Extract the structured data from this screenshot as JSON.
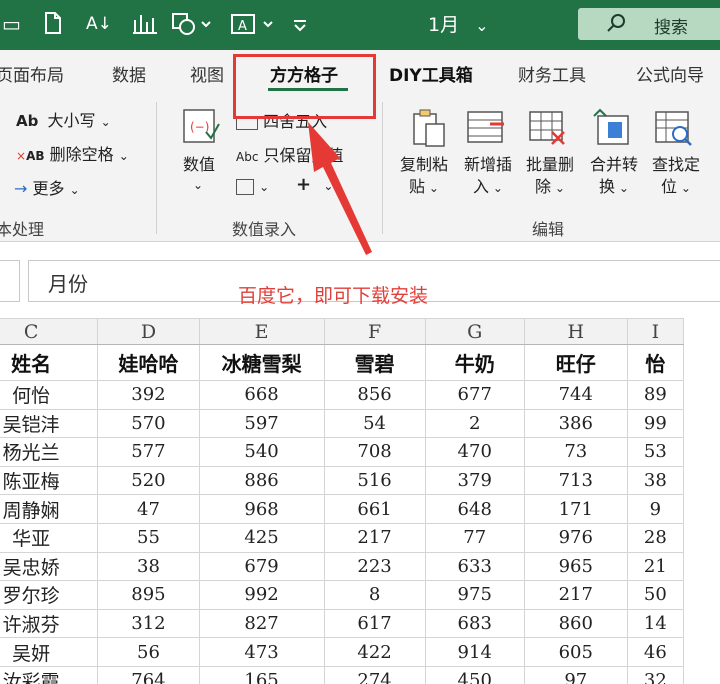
{
  "quick_access": {
    "icons": [
      "save-icon",
      "new-doc-icon",
      "sort-az-icon",
      "chart-icon",
      "shapes-icon",
      "textbox-icon",
      "customize-icon"
    ]
  },
  "title": {
    "text": "1月",
    "caret": "⌄"
  },
  "search": {
    "label": "搜索",
    "icon": "search-icon"
  },
  "tabs": [
    {
      "label": "页面布局"
    },
    {
      "label": "数据"
    },
    {
      "label": "视图"
    },
    {
      "label": "方方格子",
      "active": true
    },
    {
      "label": "DIY工具箱"
    },
    {
      "label": "财务工具"
    },
    {
      "label": "公式向导"
    }
  ],
  "ribbon": {
    "text_group": {
      "case": "大小写",
      "case_icon_text": "Ab",
      "delete_space": "删除空格",
      "delete_space_icon_text": "AB",
      "more": "更多",
      "label": "本处理"
    },
    "value_group": {
      "value_button": "数值",
      "round": "四舍五入",
      "keep_value": "只保留数值",
      "keep_icon_text": "Abc",
      "label": "数值录入"
    },
    "edit_group": {
      "buttons": [
        {
          "line1": "复制粘",
          "line2": "贴"
        },
        {
          "line1": "新增插",
          "line2": "入"
        },
        {
          "line1": "批量删",
          "line2": "除"
        },
        {
          "line1": "合并转",
          "line2": "换"
        },
        {
          "line1": "查找定",
          "line2": "位"
        }
      ],
      "label": "编辑"
    }
  },
  "formula_bar": {
    "value": "月份"
  },
  "annotation": "百度它，即可下载安装",
  "sheet": {
    "columns": [
      "C",
      "D",
      "E",
      "F",
      "G",
      "H",
      "I"
    ],
    "header": [
      "姓名",
      "娃哈哈",
      "冰糖雪梨",
      "雪碧",
      "牛奶",
      "旺仔",
      "怡"
    ],
    "rows": [
      [
        "何怡",
        "392",
        "668",
        "856",
        "677",
        "744",
        "89"
      ],
      [
        "吴铠沣",
        "570",
        "597",
        "54",
        "2",
        "386",
        "99"
      ],
      [
        "杨光兰",
        "577",
        "540",
        "708",
        "470",
        "73",
        "53"
      ],
      [
        "陈亚梅",
        "520",
        "886",
        "516",
        "379",
        "713",
        "38"
      ],
      [
        "周静娴",
        "47",
        "968",
        "661",
        "648",
        "171",
        "9"
      ],
      [
        "华亚",
        "55",
        "425",
        "217",
        "77",
        "976",
        "28"
      ],
      [
        "吴忠娇",
        "38",
        "679",
        "223",
        "633",
        "965",
        "21"
      ],
      [
        "罗尔珍",
        "895",
        "992",
        "8",
        "975",
        "217",
        "50"
      ],
      [
        "许淑芬",
        "312",
        "827",
        "617",
        "683",
        "860",
        "14"
      ],
      [
        "吴妍",
        "56",
        "473",
        "422",
        "914",
        "605",
        "46"
      ],
      [
        "汝彩霞",
        "764",
        "165",
        "274",
        "450",
        "97",
        "32"
      ]
    ]
  },
  "colors": {
    "accent": "#217346",
    "annotation": "#e53935"
  }
}
